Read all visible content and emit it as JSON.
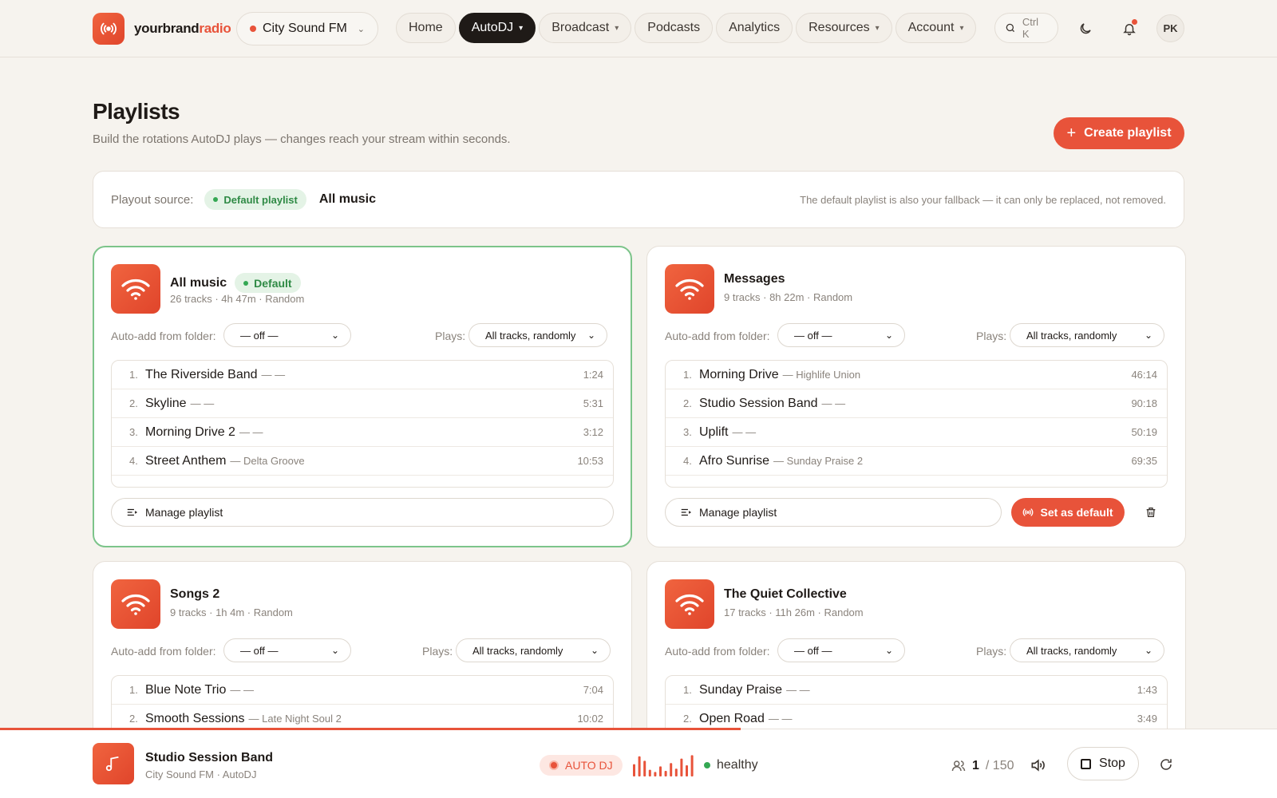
{
  "brand": {
    "name_main": "yourbrand",
    "name_accent": "radio"
  },
  "station": {
    "name": "City Sound FM"
  },
  "nav": {
    "home": "Home",
    "autodj": "AutoDJ",
    "broadcast": "Broadcast",
    "podcasts": "Podcasts",
    "analytics": "Analytics",
    "resources": "Resources",
    "account": "Account",
    "search_hint": "Ctrl K",
    "avatar": "PK"
  },
  "header": {
    "title": "Playlists",
    "subtitle": "Build the rotations AutoDJ plays — changes reach your stream within seconds.",
    "create": "Create playlist"
  },
  "playout": {
    "label": "Playout source:",
    "badge": "Default playlist",
    "value": "All music",
    "note": "The default playlist is also your fallback — it can only be replaced, not removed."
  },
  "labels": {
    "auto_add": "Auto-add from folder:",
    "plays": "Plays:",
    "manage": "Manage playlist",
    "set_default": "Set as default",
    "default_badge": "Default"
  },
  "cards": [
    {
      "name": "All music",
      "meta": "26 tracks · 4h 47m · Random",
      "is_default": true,
      "folder": "— off —",
      "plays": "All tracks, randomly",
      "tracks": [
        {
          "n": "1.",
          "title": "The Riverside Band",
          "artist": "— —",
          "dur": "1:24"
        },
        {
          "n": "2.",
          "title": "Skyline",
          "artist": "— —",
          "dur": "5:31"
        },
        {
          "n": "3.",
          "title": "Morning Drive 2",
          "artist": "— —",
          "dur": "3:12"
        },
        {
          "n": "4.",
          "title": "Street Anthem",
          "artist": "— Delta Groove",
          "dur": "10:53"
        }
      ]
    },
    {
      "name": "Messages",
      "meta": "9 tracks · 8h 22m · Random",
      "is_default": false,
      "folder": "— off —",
      "plays": "All tracks, randomly",
      "tracks": [
        {
          "n": "1.",
          "title": "Morning Drive",
          "artist": "— Highlife Union",
          "dur": "46:14"
        },
        {
          "n": "2.",
          "title": "Studio Session Band",
          "artist": "— —",
          "dur": "90:18"
        },
        {
          "n": "3.",
          "title": "Uplift",
          "artist": "— —",
          "dur": "50:19"
        },
        {
          "n": "4.",
          "title": "Afro Sunrise",
          "artist": "— Sunday Praise 2",
          "dur": "69:35"
        }
      ]
    },
    {
      "name": "Songs 2",
      "meta": "9 tracks · 1h 4m · Random",
      "is_default": false,
      "folder": "— off —",
      "plays": "All tracks, randomly",
      "tracks": [
        {
          "n": "1.",
          "title": "Blue Note Trio",
          "artist": "— —",
          "dur": "7:04"
        },
        {
          "n": "2.",
          "title": "Smooth Sessions",
          "artist": "— Late Night Soul 2",
          "dur": "10:02"
        }
      ]
    },
    {
      "name": "The Quiet Collective",
      "meta": "17 tracks · 11h 26m · Random",
      "is_default": false,
      "folder": "— off —",
      "plays": "All tracks, randomly",
      "tracks": [
        {
          "n": "1.",
          "title": "Sunday Praise",
          "artist": "— —",
          "dur": "1:43"
        },
        {
          "n": "2.",
          "title": "Open Road",
          "artist": "— —",
          "dur": "3:49"
        }
      ]
    }
  ],
  "player": {
    "title": "Studio Session Band",
    "sub": "City Sound FM · AutoDJ",
    "mode": "AUTO DJ",
    "health": "healthy",
    "listeners": "1",
    "capacity": "/ 150",
    "stop": "Stop",
    "progress": 0.58,
    "levels": [
      0.55,
      0.9,
      0.7,
      0.3,
      0.2,
      0.45,
      0.25,
      0.6,
      0.35,
      0.8,
      0.5,
      0.95
    ]
  },
  "colors": {
    "accent": "#e8533a",
    "success": "#34a853",
    "default_border": "#7cc48a"
  }
}
